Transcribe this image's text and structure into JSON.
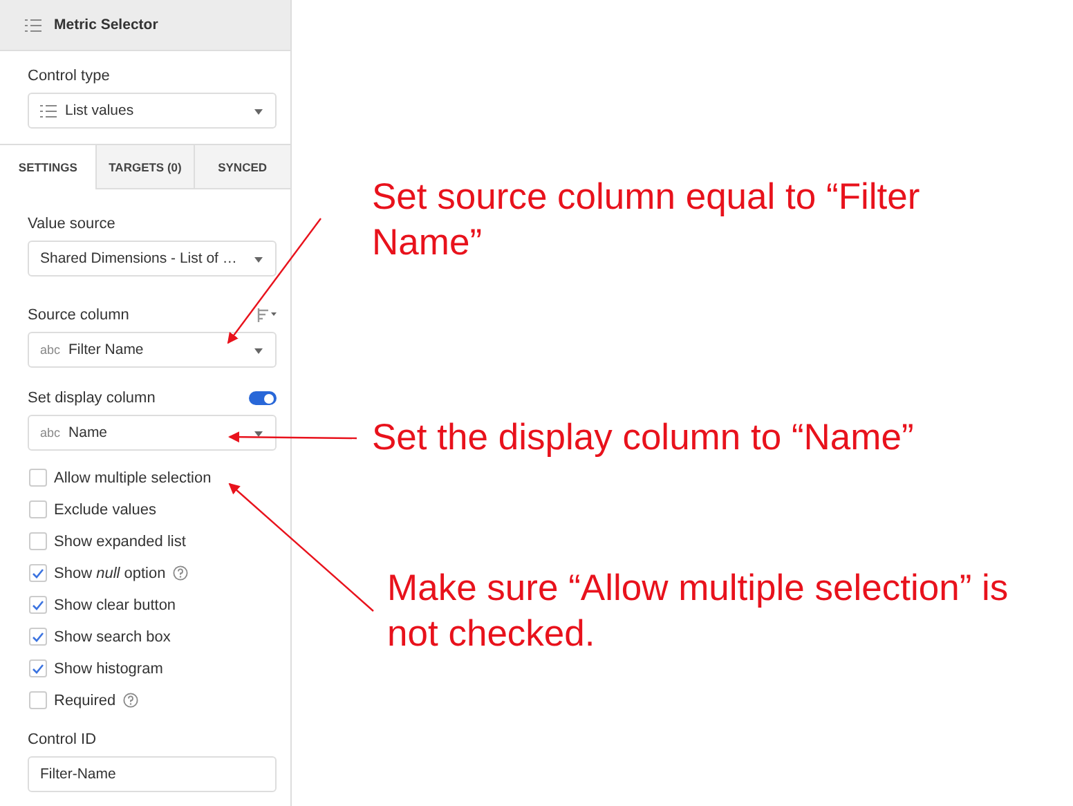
{
  "panel": {
    "title": "Metric Selector"
  },
  "control_type": {
    "label": "Control type",
    "value": "List values"
  },
  "tabs": [
    {
      "label": "SETTINGS",
      "selected": true
    },
    {
      "label": "TARGETS (0)",
      "selected": false
    },
    {
      "label": "SYNCED",
      "selected": false
    }
  ],
  "value_source": {
    "label": "Value source",
    "value": "Shared Dimensions - List of …"
  },
  "source_column": {
    "label": "Source column",
    "value_type": "abc",
    "value": "Filter Name"
  },
  "display_column": {
    "label": "Set display column",
    "on": true,
    "value_type": "abc",
    "value": "Name"
  },
  "options": [
    {
      "label": "Allow multiple selection",
      "checked": false,
      "help": false
    },
    {
      "label": "Exclude values",
      "checked": false,
      "help": false
    },
    {
      "label": "Show expanded list",
      "checked": false,
      "help": false
    },
    {
      "label": "Show *null* option",
      "checked": true,
      "help": true
    },
    {
      "label": "Show clear button",
      "checked": true,
      "help": false
    },
    {
      "label": "Show search box",
      "checked": true,
      "help": false
    },
    {
      "label": "Show histogram",
      "checked": true,
      "help": false
    },
    {
      "label": "Required",
      "checked": false,
      "help": true
    }
  ],
  "control_id": {
    "label": "Control ID",
    "value": "Filter-Name"
  },
  "annotations": [
    "Set source column equal to “Filter Name”",
    "Set the display column to “Name”",
    "Make sure “Allow multiple selection” is not checked."
  ]
}
